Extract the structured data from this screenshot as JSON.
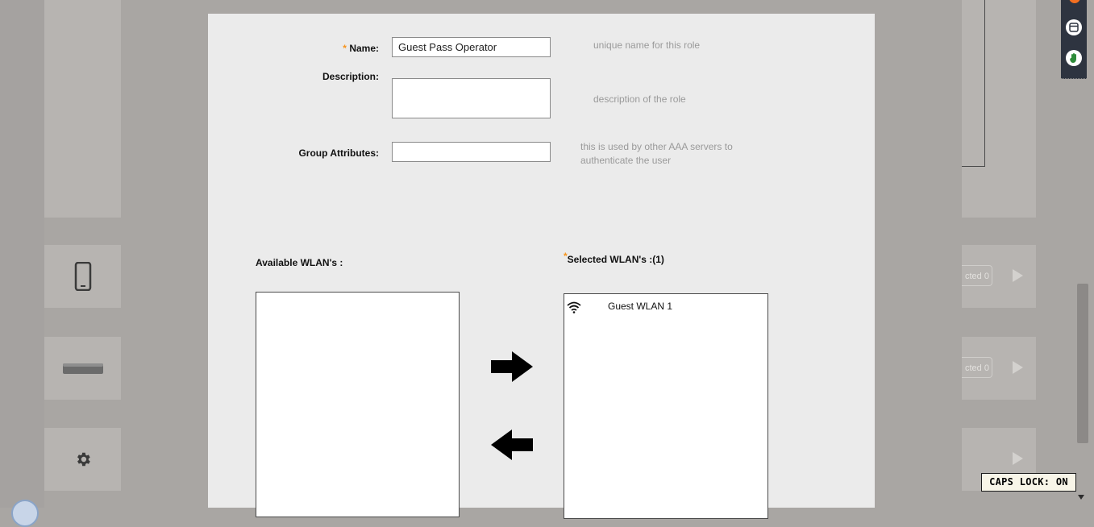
{
  "form": {
    "name_label": "Name:",
    "name_value": "Guest Pass Operator",
    "name_hint": "unique name for this role",
    "description_label": "Description:",
    "description_value": "",
    "description_hint": "description of the role",
    "group_attr_label": "Group Attributes:",
    "group_attr_value": "",
    "group_attr_hint_line1": "this is used by other AAA servers to",
    "group_attr_hint_line2": "authenticate the user",
    "required_marker": "*"
  },
  "wlans": {
    "available_label": "Available WLAN's :",
    "available_items": [],
    "selected_label": "Selected WLAN's :(1)",
    "selected_items": [
      {
        "label": "Guest WLAN 1",
        "icon": "wifi-icon"
      }
    ]
  },
  "background": {
    "row1_selected": "cted 0",
    "row2_selected": "cted 0"
  },
  "caps_lock": "CAPS LOCK: ON",
  "colors": {
    "required": "#f7941d",
    "modal_bg": "#ebebeb",
    "overlay_bg": "#a9a6a3"
  }
}
